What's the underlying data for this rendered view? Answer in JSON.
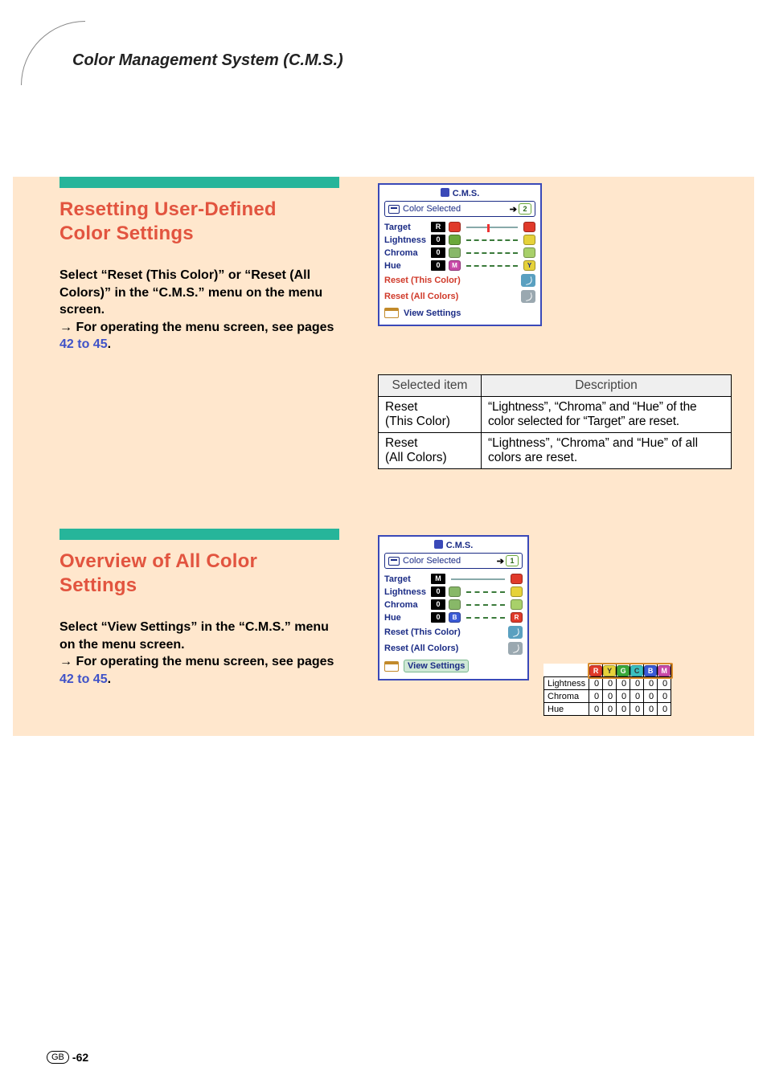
{
  "page": {
    "title": "Color Management System (C.M.S.)",
    "region_code": "GB",
    "page_num_prefix": "-",
    "page_num": "62"
  },
  "section1": {
    "heading_l1": "Resetting User-Defined",
    "heading_l2": "Color Settings",
    "body_p1": "Select “Reset (This Color)” or “Reset (All Colors)” in the “C.M.S.” menu on the menu screen.",
    "body_arrow": "→",
    "body_p2_a": " For operating the menu screen, see pages ",
    "body_link": "42 to 45",
    "body_p2_b": "."
  },
  "osd1": {
    "title": "C.M.S.",
    "sub": "Color Selected",
    "sub_badge": "2",
    "rows": {
      "target": {
        "label": "Target",
        "val": "R"
      },
      "lightness": {
        "label": "Lightness",
        "val": "0"
      },
      "chroma": {
        "label": "Chroma",
        "val": "0"
      },
      "hue": {
        "label": "Hue",
        "val": "0"
      }
    },
    "reset_this": "Reset (This Color)",
    "reset_all": "Reset (All Colors)",
    "view": "View Settings"
  },
  "desc_table": {
    "h1": "Selected item",
    "h2": "Description",
    "r1c1a": "Reset",
    "r1c1b": "(This Color)",
    "r1c2": "“Lightness”, “Chroma” and “Hue” of the color selected for “Target” are reset.",
    "r2c1a": "Reset",
    "r2c1b": "(All Colors)",
    "r2c2": "“Lightness”, “Chroma” and “Hue” of all colors are reset."
  },
  "section2": {
    "heading_l1": "Overview of All Color",
    "heading_l2": "Settings",
    "body_p1": "Select “View Settings” in the “C.M.S.” menu on the menu screen.",
    "body_arrow": "→",
    "body_p2_a": " For operating the menu screen, see pages ",
    "body_link": "42 to 45",
    "body_p2_b": "."
  },
  "osd2": {
    "title": "C.M.S.",
    "sub": "Color Selected",
    "sub_badge": "1",
    "rows": {
      "target": {
        "label": "Target",
        "val": "M"
      },
      "lightness": {
        "label": "Lightness",
        "val": "0"
      },
      "chroma": {
        "label": "Chroma",
        "val": "0"
      },
      "hue": {
        "label": "Hue",
        "val": "0"
      }
    },
    "reset_this": "Reset (This Color)",
    "reset_all": "Reset (All Colors)",
    "view": "View Settings"
  },
  "matrix": {
    "headers": [
      "R",
      "Y",
      "G",
      "C",
      "B",
      "M"
    ],
    "header_colors": [
      "#e03a2a",
      "#e6d23a",
      "#3aa83a",
      "#3ac0c0",
      "#3a5ad6",
      "#c84aa8"
    ],
    "rows": [
      {
        "label": "Lightness",
        "vals": [
          "0",
          "0",
          "0",
          "0",
          "0",
          "0"
        ]
      },
      {
        "label": "Chroma",
        "vals": [
          "0",
          "0",
          "0",
          "0",
          "0",
          "0"
        ]
      },
      {
        "label": "Hue",
        "vals": [
          "0",
          "0",
          "0",
          "0",
          "0",
          "0"
        ]
      }
    ]
  }
}
